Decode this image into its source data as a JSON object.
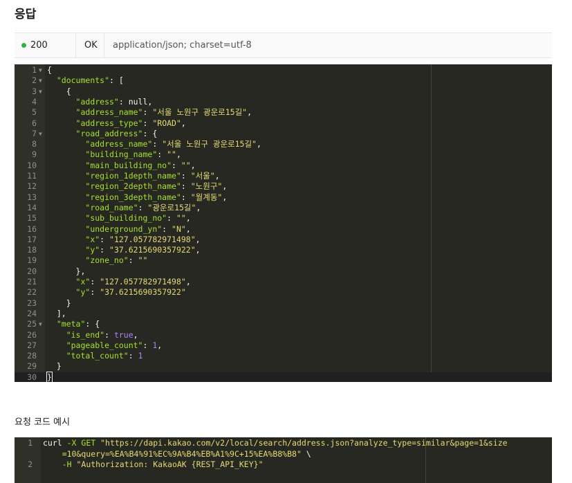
{
  "response": {
    "title": "응답",
    "status_code": "200",
    "status_text": "OK",
    "content_type": "application/json; charset=utf-8",
    "status_color": "#2fb344"
  },
  "code_lines": [
    {
      "n": "1",
      "fold": true,
      "parts": [
        [
          "p",
          "{"
        ]
      ]
    },
    {
      "n": "2",
      "fold": true,
      "parts": [
        [
          "p",
          "  "
        ],
        [
          "k",
          "\"documents\""
        ],
        [
          "p",
          ": ["
        ]
      ]
    },
    {
      "n": "3",
      "fold": true,
      "parts": [
        [
          "p",
          "    {"
        ]
      ]
    },
    {
      "n": "4",
      "parts": [
        [
          "p",
          "      "
        ],
        [
          "k",
          "\"address\""
        ],
        [
          "p",
          ": null,"
        ]
      ]
    },
    {
      "n": "5",
      "parts": [
        [
          "p",
          "      "
        ],
        [
          "k",
          "\"address_name\""
        ],
        [
          "p",
          ": "
        ],
        [
          "s",
          "\"서울 노원구 광운로15길\""
        ],
        [
          "p",
          ","
        ]
      ]
    },
    {
      "n": "6",
      "parts": [
        [
          "p",
          "      "
        ],
        [
          "k",
          "\"address_type\""
        ],
        [
          "p",
          ": "
        ],
        [
          "s",
          "\"ROAD\""
        ],
        [
          "p",
          ","
        ]
      ]
    },
    {
      "n": "7",
      "fold": true,
      "parts": [
        [
          "p",
          "      "
        ],
        [
          "k",
          "\"road_address\""
        ],
        [
          "p",
          ": {"
        ]
      ]
    },
    {
      "n": "8",
      "parts": [
        [
          "p",
          "        "
        ],
        [
          "k",
          "\"address_name\""
        ],
        [
          "p",
          ": "
        ],
        [
          "s",
          "\"서울 노원구 광운로15길\""
        ],
        [
          "p",
          ","
        ]
      ]
    },
    {
      "n": "9",
      "parts": [
        [
          "p",
          "        "
        ],
        [
          "k",
          "\"building_name\""
        ],
        [
          "p",
          ": "
        ],
        [
          "s",
          "\"\""
        ],
        [
          "p",
          ","
        ]
      ]
    },
    {
      "n": "10",
      "parts": [
        [
          "p",
          "        "
        ],
        [
          "k",
          "\"main_building_no\""
        ],
        [
          "p",
          ": "
        ],
        [
          "s",
          "\"\""
        ],
        [
          "p",
          ","
        ]
      ]
    },
    {
      "n": "11",
      "parts": [
        [
          "p",
          "        "
        ],
        [
          "k",
          "\"region_1depth_name\""
        ],
        [
          "p",
          ": "
        ],
        [
          "s",
          "\"서울\""
        ],
        [
          "p",
          ","
        ]
      ]
    },
    {
      "n": "12",
      "parts": [
        [
          "p",
          "        "
        ],
        [
          "k",
          "\"region_2depth_name\""
        ],
        [
          "p",
          ": "
        ],
        [
          "s",
          "\"노원구\""
        ],
        [
          "p",
          ","
        ]
      ]
    },
    {
      "n": "13",
      "parts": [
        [
          "p",
          "        "
        ],
        [
          "k",
          "\"region_3depth_name\""
        ],
        [
          "p",
          ": "
        ],
        [
          "s",
          "\"월계동\""
        ],
        [
          "p",
          ","
        ]
      ]
    },
    {
      "n": "14",
      "parts": [
        [
          "p",
          "        "
        ],
        [
          "k",
          "\"road_name\""
        ],
        [
          "p",
          ": "
        ],
        [
          "s",
          "\"광운로15길\""
        ],
        [
          "p",
          ","
        ]
      ]
    },
    {
      "n": "15",
      "parts": [
        [
          "p",
          "        "
        ],
        [
          "k",
          "\"sub_building_no\""
        ],
        [
          "p",
          ": "
        ],
        [
          "s",
          "\"\""
        ],
        [
          "p",
          ","
        ]
      ]
    },
    {
      "n": "16",
      "parts": [
        [
          "p",
          "        "
        ],
        [
          "k",
          "\"underground_yn\""
        ],
        [
          "p",
          ": "
        ],
        [
          "s",
          "\"N\""
        ],
        [
          "p",
          ","
        ]
      ]
    },
    {
      "n": "17",
      "parts": [
        [
          "p",
          "        "
        ],
        [
          "k",
          "\"x\""
        ],
        [
          "p",
          ": "
        ],
        [
          "s",
          "\"127.057782971498\""
        ],
        [
          "p",
          ","
        ]
      ]
    },
    {
      "n": "18",
      "parts": [
        [
          "p",
          "        "
        ],
        [
          "k",
          "\"y\""
        ],
        [
          "p",
          ": "
        ],
        [
          "s",
          "\"37.6215690357922\""
        ],
        [
          "p",
          ","
        ]
      ]
    },
    {
      "n": "19",
      "parts": [
        [
          "p",
          "        "
        ],
        [
          "k",
          "\"zone_no\""
        ],
        [
          "p",
          ": "
        ],
        [
          "s",
          "\"\""
        ]
      ]
    },
    {
      "n": "20",
      "parts": [
        [
          "p",
          "      },"
        ]
      ]
    },
    {
      "n": "21",
      "parts": [
        [
          "p",
          "      "
        ],
        [
          "k",
          "\"x\""
        ],
        [
          "p",
          ": "
        ],
        [
          "s",
          "\"127.057782971498\""
        ],
        [
          "p",
          ","
        ]
      ]
    },
    {
      "n": "22",
      "parts": [
        [
          "p",
          "      "
        ],
        [
          "k",
          "\"y\""
        ],
        [
          "p",
          ": "
        ],
        [
          "s",
          "\"37.6215690357922\""
        ]
      ]
    },
    {
      "n": "23",
      "parts": [
        [
          "p",
          "    }"
        ]
      ]
    },
    {
      "n": "24",
      "parts": [
        [
          "p",
          "  ],"
        ]
      ]
    },
    {
      "n": "25",
      "fold": true,
      "parts": [
        [
          "p",
          "  "
        ],
        [
          "k",
          "\"meta\""
        ],
        [
          "p",
          ": {"
        ]
      ]
    },
    {
      "n": "26",
      "parts": [
        [
          "p",
          "    "
        ],
        [
          "k",
          "\"is_end\""
        ],
        [
          "p",
          ": "
        ],
        [
          "n",
          "true"
        ],
        [
          "p",
          ","
        ]
      ]
    },
    {
      "n": "27",
      "parts": [
        [
          "p",
          "    "
        ],
        [
          "k",
          "\"pageable_count\""
        ],
        [
          "p",
          ": "
        ],
        [
          "n",
          "1"
        ],
        [
          "p",
          ","
        ]
      ]
    },
    {
      "n": "28",
      "parts": [
        [
          "p",
          "    "
        ],
        [
          "k",
          "\"total_count\""
        ],
        [
          "p",
          ": "
        ],
        [
          "n",
          "1"
        ]
      ]
    },
    {
      "n": "29",
      "parts": [
        [
          "p",
          "  }"
        ]
      ]
    },
    {
      "n": "30",
      "active": true,
      "parts": [
        [
          "p",
          "}"
        ]
      ]
    }
  ],
  "example": {
    "title": "요청 코드 예시",
    "lines": [
      {
        "n": "1",
        "parts": [
          [
            "p",
            "curl "
          ],
          [
            "k",
            "-X GET "
          ],
          [
            "s",
            "\"https://dapi.kakao.com/v2/local/search/address.json?analyze_type=similar&page=1&size"
          ]
        ]
      },
      {
        "n": "",
        "parts": [
          [
            "s",
            "    =10&query=%EA%B4%91%EC%9A%B4%EB%A1%9C+15%EA%B8%B8\""
          ],
          [
            "p",
            " \\"
          ]
        ]
      },
      {
        "n": "2",
        "parts": [
          [
            "p",
            "    "
          ],
          [
            "k",
            "-H "
          ],
          [
            "s",
            "\"Authorization: KakaoAK {REST_API_KEY}\""
          ]
        ]
      }
    ]
  }
}
